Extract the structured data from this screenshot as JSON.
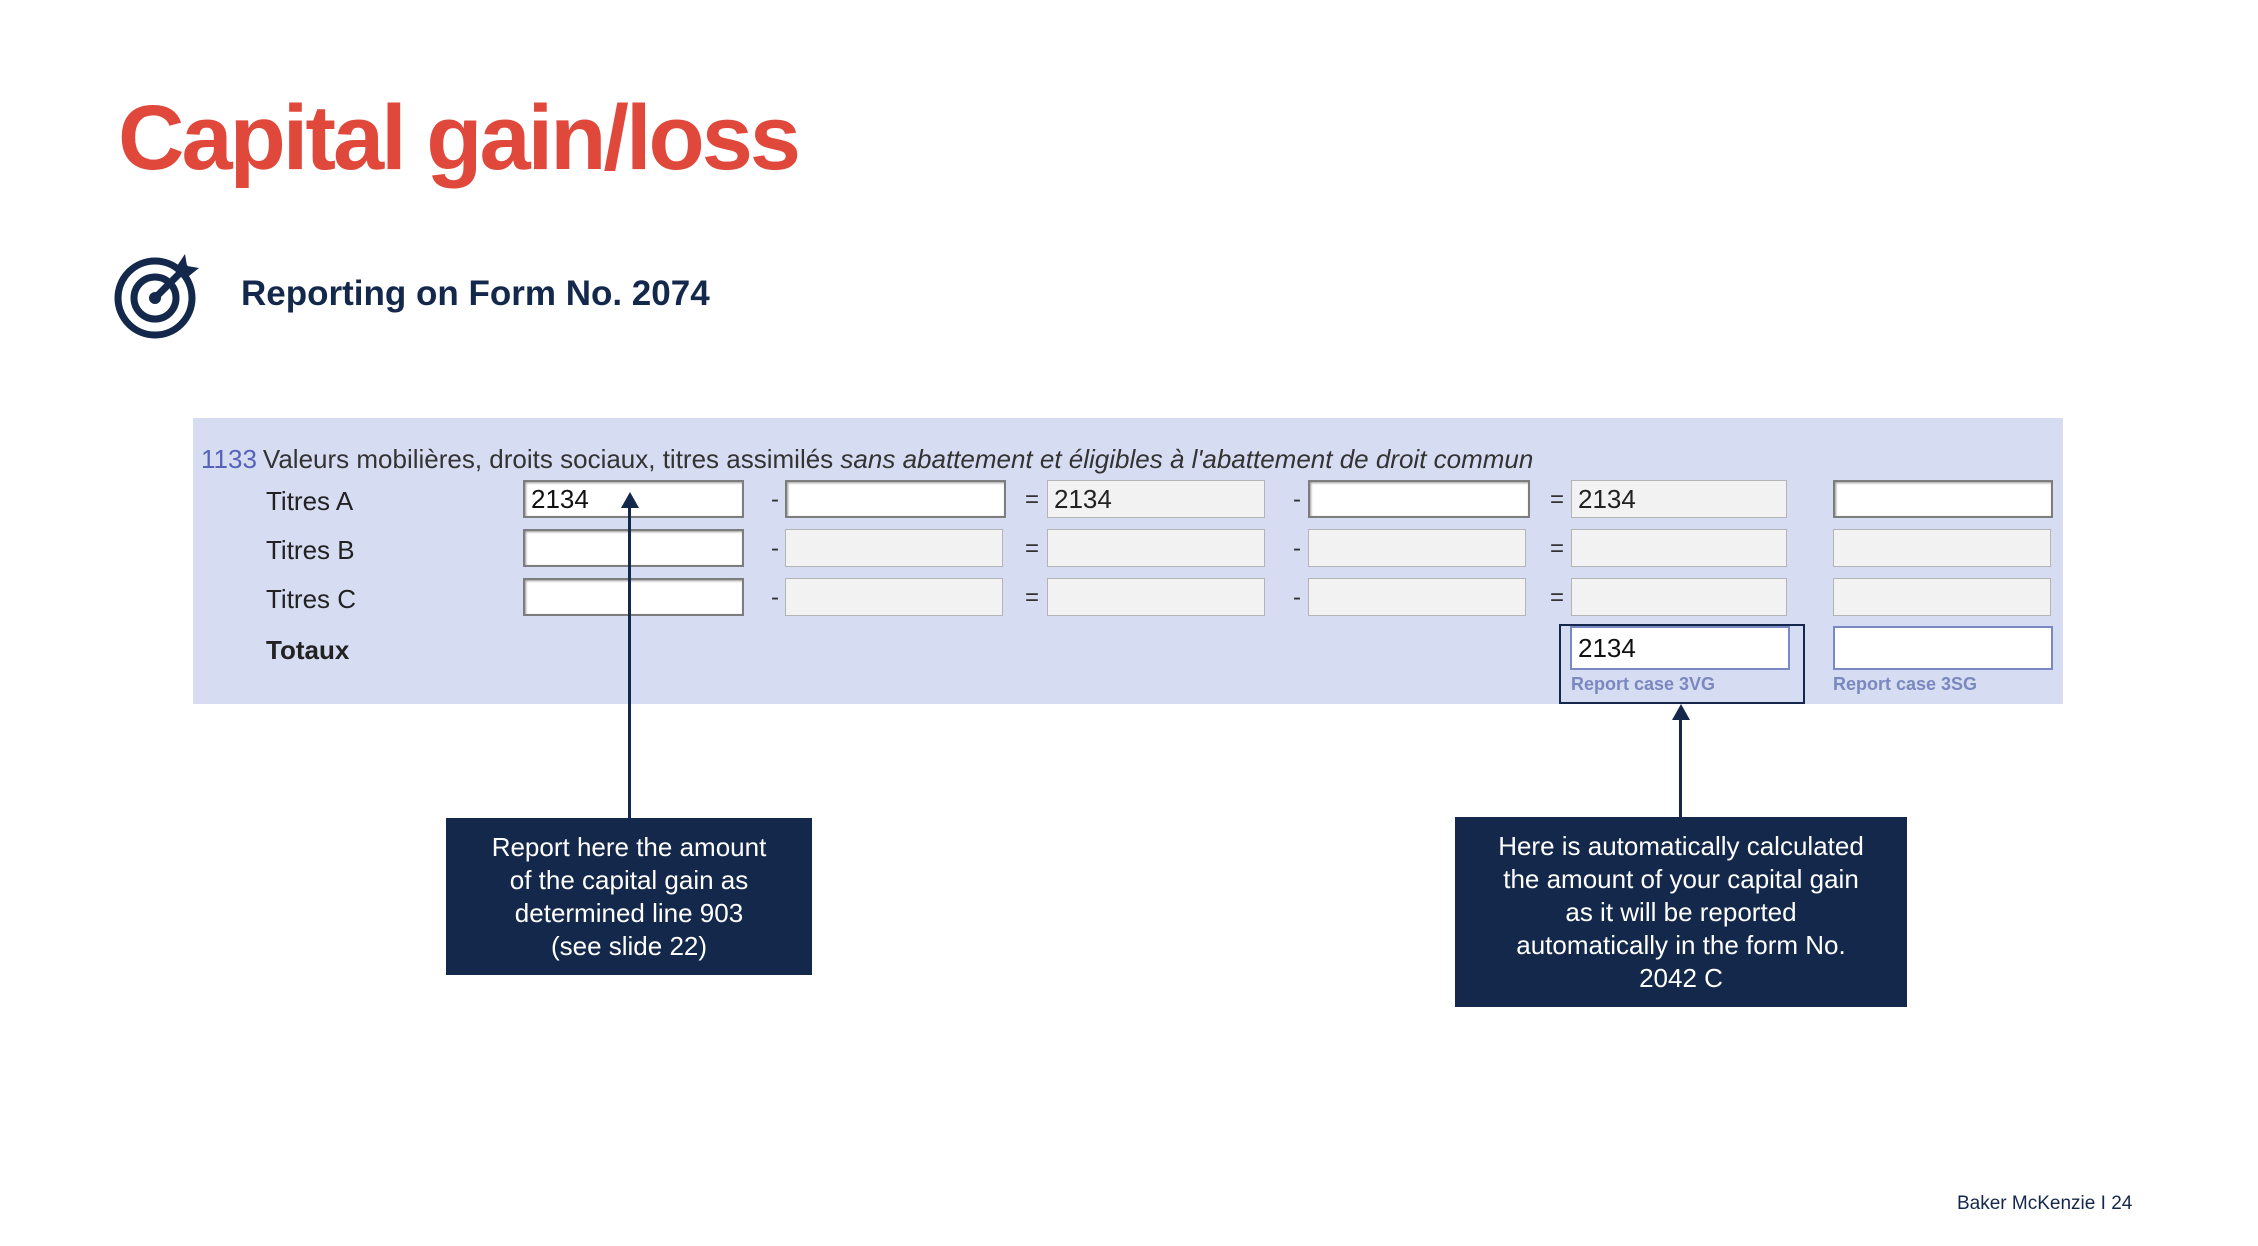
{
  "slide": {
    "title": "Capital gain/loss",
    "subtitle": "Reporting on Form No. 2074",
    "subtitle_icon": "target-icon",
    "footer_brand": "Baker McKenzie",
    "footer_separator": "I",
    "page_number": "24"
  },
  "form": {
    "section_number": "1133",
    "section_title_plain": "Valeurs mobilières, droits sociaux, titres assimilés",
    "section_title_italic": "sans abattement et éligibles à l'abattement de droit commun",
    "operators": [
      "-",
      "=",
      "-",
      "="
    ],
    "rows": [
      {
        "label": "Titres A",
        "values": [
          "2134",
          "",
          "2134",
          "",
          "2134",
          ""
        ]
      },
      {
        "label": "Titres B",
        "values": [
          "",
          "",
          "",
          "",
          "",
          ""
        ]
      },
      {
        "label": "Titres C",
        "values": [
          "",
          "",
          "",
          "",
          "",
          ""
        ]
      }
    ],
    "totals": {
      "label": "Totaux",
      "gain_value": "2134",
      "loss_value": "",
      "gain_report_label": "Report case 3VG",
      "loss_report_label": "Report case 3SG"
    }
  },
  "callouts": {
    "left": "Report here the amount\nof the capital gain as\ndetermined line 903\n(see slide 22)",
    "right": "Here is automatically calculated\nthe amount of your capital gain\nas it will be reported\nautomatically in the form No.\n2042 C"
  },
  "colors": {
    "title": "#e0483c",
    "navy": "#14284b",
    "panel_background": "#d6dcf1"
  }
}
